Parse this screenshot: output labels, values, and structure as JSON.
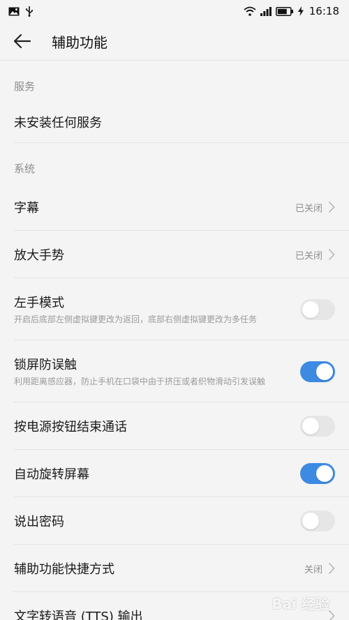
{
  "status_bar": {
    "left_icons": [
      "image-icon",
      "usb-icon"
    ],
    "right_icons": [
      "wifi-icon",
      "signal-icon",
      "battery-icon",
      "charging-icon"
    ],
    "time": "16:18"
  },
  "app_bar": {
    "title": "辅助功能",
    "back_icon": "back-arrow-icon"
  },
  "sections": [
    {
      "header": "服务",
      "items": [
        {
          "label": "未安装任何服务"
        }
      ]
    },
    {
      "header": "系统",
      "items": [
        {
          "label": "字幕",
          "value": "已关闭"
        },
        {
          "label": "放大手势",
          "value": "已关闭"
        },
        {
          "label": "左手模式",
          "description": "开启后底部左侧虚拟键更改为返回，底部右侧虚拟键更改为多任务",
          "toggle": "off"
        },
        {
          "label": "锁屏防误触",
          "description": "利用距离感应器，防止手机在口袋中由于挤压或者织物滑动引发误触",
          "toggle": "on"
        },
        {
          "label": "按电源按钮结束通话",
          "toggle": "off"
        },
        {
          "label": "自动旋转屏幕",
          "toggle": "on"
        },
        {
          "label": "说出密码",
          "toggle": "off"
        },
        {
          "label": "辅助功能快捷方式",
          "value": "关闭"
        },
        {
          "label": "文字转语音 (TTS) 输出"
        }
      ]
    }
  ],
  "colors": {
    "toggle_on": "#3d8ae3",
    "toggle_off": "#e6e6e6",
    "background": "#f4f4f4"
  },
  "watermark": "Bai 经验"
}
